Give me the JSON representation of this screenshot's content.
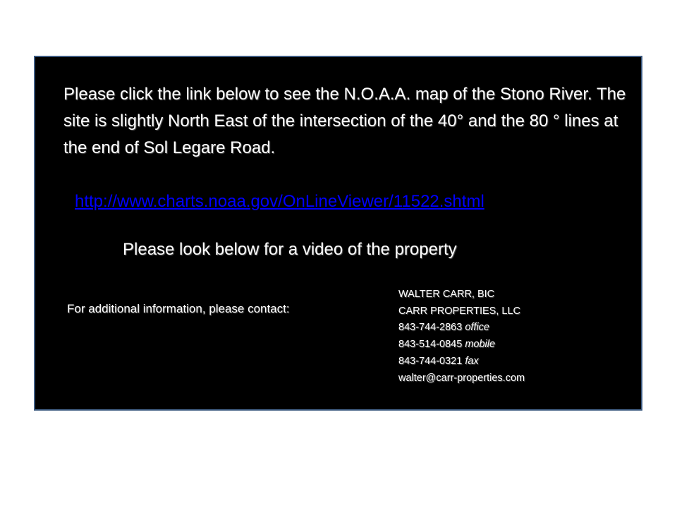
{
  "intro_text": "Please click the link below to  see the N.O.A.A. map  of the Stono River. The site is slightly North East of the intersection of the 40° and the 80 ° lines at the end of Sol Legare Road.",
  "link_text": "http://www.charts.noaa.gov/OnLineViewer/11522.shtml",
  "video_note": "Please look below for a video of the property",
  "contact_label": "For additional information, please contact:",
  "contact": {
    "name": "WALTER CARR, BIC",
    "company": "CARR PROPERTIES, LLC",
    "office_number": "843-744-2863",
    "office_label": "office",
    "mobile_number": "843-514-0845",
    "mobile_label": "mobile",
    "fax_number": "843-744-0321",
    "fax_label": "fax",
    "email": "walter@carr-properties.com"
  },
  "colors": {
    "panel_background": "#000000",
    "panel_border": "#3d5a80",
    "text": "#ffffff",
    "link": "#0000ff"
  }
}
